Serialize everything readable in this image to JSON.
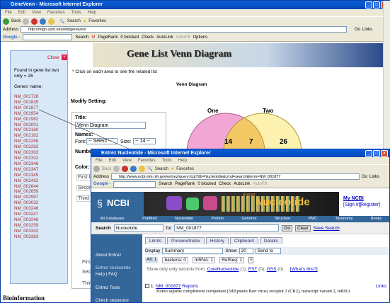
{
  "back_window": {
    "title": "GeneVenn - Microsoft Internet Explorer",
    "menu": [
      "File",
      "Edit",
      "View",
      "Favorites",
      "Tools",
      "Help"
    ],
    "toolbar": {
      "back": "Back",
      "search": "Search",
      "favorites": "Favorites"
    },
    "address_label": "Address",
    "address": "http://mfgn.usm.edu/ebl/geneven/",
    "go": "Go",
    "links": "Links",
    "google": {
      "label": "Google -",
      "search": "Search",
      "pagerank": "PageRank",
      "blocked": "0 blocked",
      "check": "Check",
      "autolink": "AutoLink",
      "autofill": "AutoFill",
      "options": "Options"
    },
    "page": {
      "banner": "Gene List Venn Diagram",
      "instruction": "* Click on each area to see the related list",
      "venn_title": "Venn Diagram",
      "modify": "Modify Setting:",
      "title_label": "Title:",
      "title_value": "Venn Diagram",
      "names_label": "Names:",
      "font_label": "Font:",
      "font_value": "-- Select --",
      "size_label": "Size:",
      "size_value": "-- 14 --",
      "numbers_label": "Numbe",
      "color_label": "Color:",
      "rows": [
        "First L",
        "Secon",
        "Third L"
      ],
      "lower_rows": [
        "First",
        "Secon",
        "Thir"
      ],
      "venn": {
        "left_name": "One",
        "right_name": "Two",
        "left_only": "14",
        "overlap": "7",
        "right_only": "26"
      }
    },
    "popup": {
      "close": "Close",
      "found": "Found in gene list two only = 26",
      "genes_label": "Genes' name:",
      "genes": [
        "NM_001728",
        "NM_001835",
        "NM_001877",
        "NM_001954",
        "NM_001992",
        "NM_002001",
        "NM_002160",
        "NM_002162",
        "NM_002258",
        "NM_002262",
        "NM_002303",
        "NM_002332",
        "NM_002346",
        "NM_002347",
        "NM_002349",
        "NM_002432",
        "NM_002644",
        "NM_002659",
        "NM_002997",
        "NM_003032",
        "NM_003246",
        "NM_003247",
        "NM_003248",
        "NM_003259",
        "NM_003332",
        "NM_003383"
      ]
    },
    "caption": "Bioinformation"
  },
  "front_window": {
    "title": "Entrez Nucleotide - Microsoft Internet Explorer",
    "menu": [
      "File",
      "Edit",
      "View",
      "Favorites",
      "Tools",
      "Help"
    ],
    "toolbar": {
      "back": "Back",
      "search": "Search",
      "favorites": "Favorites"
    },
    "address_label": "Address",
    "address": "http://www.ncbi.nlm.nih.gov/entrez/query.fcgi?db=Nucleotide&cmd=search&term=NM_001877",
    "go": "Go",
    "links": "Links",
    "google": {
      "label": "Google -",
      "search": "Search",
      "pagerank": "PageRank",
      "blocked": "0 blocked",
      "check": "Check",
      "autolink": "AutoLink",
      "autofill": "AutoFill"
    },
    "ncbi": {
      "logo": "NCBI",
      "entrez": "Entrez",
      "product": "Nucleotide",
      "my_ncbi": "My NCBI",
      "sign_in": "[Sign In]",
      "register": "[Register]",
      "nav": [
        "All Databases",
        "PubMed",
        "Nucleotide",
        "Protein",
        "Genome",
        "Structure",
        "PMC",
        "Taxonomy",
        "Books"
      ],
      "search_label": "Search",
      "db_value": "Nucleotide",
      "for_label": "for",
      "query": "NM_001877",
      "go": "Go",
      "clear": "Clear",
      "save": "Save Search",
      "tabs": [
        "Limits",
        "Preview/Index",
        "History",
        "Clipboard",
        "Details"
      ],
      "sidebar": [
        "About Entrez",
        "Entrez Nucleotide",
        "Help | FAQ",
        "Entrez Tools",
        "Check sequence"
      ],
      "display_label": "Display",
      "display_value": "Summary",
      "show_label": "Show",
      "show_value": "20",
      "sendto": "Send to",
      "filters": {
        "all": "All: 1",
        "bacteria": "bacteria: 0",
        "mrna": "mRNA: 1",
        "refseq": "RefSeq: 1"
      },
      "show_only_prefix": "Show only only records from:",
      "coren": "CoreNucleotide",
      "coren_n": "(1),",
      "est": "EST",
      "est_n": "(0),",
      "gss": "GSS",
      "gss_n": "(0).",
      "whats": "[What's this?]",
      "result": {
        "num": "1:",
        "acc": "NM_001877",
        "reports": "Reports",
        "links": "Links",
        "desc": "Homo sapiens complement component (3d/Epstein Barr virus) receptor 2 (CR2), transcript variant 2, mRNA"
      }
    }
  },
  "colors": {
    "xp_blue": "#0a5fd8",
    "circle_left": "#f2a6d4",
    "circle_right": "#fbeea0",
    "overlap": "#f5c866",
    "popup_bg": "#d8e8f7",
    "sidebar": "#336699"
  }
}
